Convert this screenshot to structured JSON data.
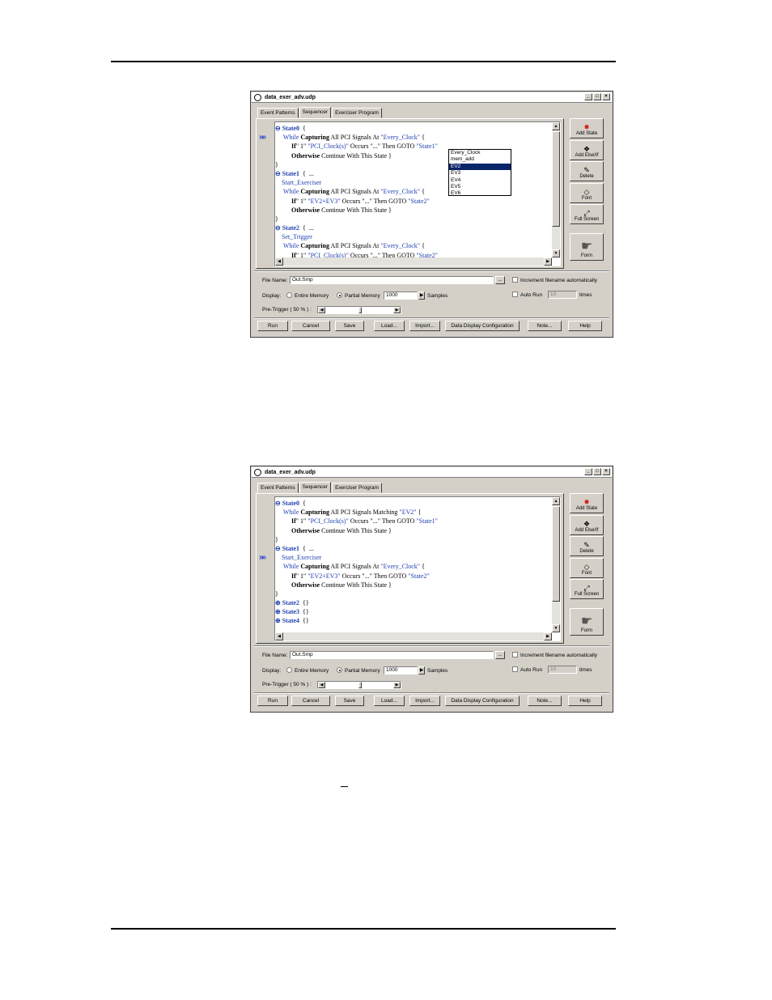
{
  "window1": {
    "title": "data_exer_adv.udp",
    "tabs": [
      "Event Patterns",
      "Sequencer",
      "Exerciser Program"
    ],
    "active_tab": "Sequencer",
    "code": [
      {
        "parts": [
          [
            "st",
            "⊖ State0"
          ],
          [
            "",
            "  {"
          ]
        ]
      },
      {
        "parts": [
          [
            "kw",
            "     While "
          ],
          [
            "bd",
            "Capturing"
          ],
          [
            "",
            " All PCI Signals At "
          ],
          [
            "str",
            "\"Every_Clock\""
          ],
          [
            "",
            " {"
          ]
        ]
      },
      {
        "parts": [
          [
            "bd",
            "          If"
          ],
          [
            "",
            "\" 1\" "
          ],
          [
            "str",
            "\"PCI_Clock(s)\""
          ],
          [
            "",
            " Occurs \"...\" Then GOTO "
          ],
          [
            "str",
            "\"State1\""
          ]
        ]
      },
      {
        "parts": [
          [
            "bd",
            "          Otherwise"
          ],
          [
            "",
            " Continue With This State }"
          ]
        ]
      },
      {
        "parts": [
          [
            "",
            "}"
          ]
        ]
      },
      {
        "parts": [
          [
            "st",
            "⊖ State1"
          ],
          [
            "",
            "  {  ..."
          ]
        ]
      },
      {
        "parts": [
          [
            "kw",
            "    Start_Exerciser"
          ]
        ]
      },
      {
        "parts": [
          [
            "kw",
            "     While "
          ],
          [
            "bd",
            "Capturing"
          ],
          [
            "",
            " All PCI Signals At "
          ],
          [
            "str",
            "\"Every_Clock\""
          ],
          [
            "",
            " {"
          ]
        ]
      },
      {
        "parts": [
          [
            "bd",
            "          If"
          ],
          [
            "",
            "\" 1\" "
          ],
          [
            "str",
            "\"EV2+EV3\""
          ],
          [
            "",
            " Occurs \"...\" Then GOTO "
          ],
          [
            "str",
            "\"State2\""
          ]
        ]
      },
      {
        "parts": [
          [
            "bd",
            "          Otherwise"
          ],
          [
            "",
            " Continue With This State }"
          ]
        ]
      },
      {
        "parts": [
          [
            "",
            "}"
          ]
        ]
      },
      {
        "parts": [
          [
            "st",
            "⊖ State2"
          ],
          [
            "",
            "  {  ..."
          ]
        ]
      },
      {
        "parts": [
          [
            "kw",
            "    Set_Trigger"
          ]
        ]
      },
      {
        "parts": [
          [
            "kw",
            "     While "
          ],
          [
            "bd",
            "Capturing"
          ],
          [
            "",
            " All PCI Signals At "
          ],
          [
            "str",
            "\"Every_Clock\""
          ],
          [
            "",
            " {"
          ]
        ]
      },
      {
        "parts": [
          [
            "bd",
            "          If"
          ],
          [
            "",
            "\" 1\" "
          ],
          [
            "str",
            "\"PCI_Clock(s)\""
          ],
          [
            "",
            " Occurs \"...\" Then GOTO "
          ],
          [
            "str",
            "\"State2\""
          ]
        ]
      }
    ],
    "dropdown": [
      "Every_Clock",
      "mem_add",
      "EV2",
      "EV3",
      "EV4",
      "EV5",
      "EV6"
    ],
    "dropdown_selected": "EV2"
  },
  "window2": {
    "title": "data_exer_adv.udp",
    "tabs": [
      "Event Patterns",
      "Sequencer",
      "Exerciser Program"
    ],
    "active_tab": "Sequencer",
    "code": [
      {
        "parts": [
          [
            "st",
            "⊖ State0"
          ],
          [
            "",
            "  {"
          ]
        ]
      },
      {
        "parts": [
          [
            "kw",
            "     While "
          ],
          [
            "bd",
            "Capturing"
          ],
          [
            "",
            " All PCI Signals Matching "
          ],
          [
            "str",
            "\"EV2\""
          ],
          [
            "",
            " {"
          ]
        ]
      },
      {
        "parts": [
          [
            "bd",
            "          If"
          ],
          [
            "",
            "\" 1\" "
          ],
          [
            "str",
            "\"PCI_Clock(s)\""
          ],
          [
            "",
            " Occurs \"...\" Then GOTO "
          ],
          [
            "str",
            "\"State1\""
          ]
        ]
      },
      {
        "parts": [
          [
            "bd",
            "          Otherwise"
          ],
          [
            "",
            " Continue With This State }"
          ]
        ]
      },
      {
        "parts": [
          [
            "",
            "}"
          ]
        ]
      },
      {
        "parts": [
          [
            "st",
            "⊖ State1"
          ],
          [
            "",
            "  {  ..."
          ]
        ]
      },
      {
        "parts": [
          [
            "kw",
            "    Start_Exerciser"
          ]
        ]
      },
      {
        "parts": [
          [
            "kw",
            "     While "
          ],
          [
            "bd",
            "Capturing"
          ],
          [
            "",
            " All PCI Signals At "
          ],
          [
            "str",
            "\"Every_Clock\""
          ],
          [
            "",
            " {"
          ]
        ]
      },
      {
        "parts": [
          [
            "bd",
            "          If"
          ],
          [
            "",
            "\" 1\" "
          ],
          [
            "str",
            "\"EV2+EV3\""
          ],
          [
            "",
            " Occurs \"...\" Then GOTO "
          ],
          [
            "str",
            "\"State2\""
          ]
        ]
      },
      {
        "parts": [
          [
            "bd",
            "          Otherwise"
          ],
          [
            "",
            " Continue With This State }"
          ]
        ]
      },
      {
        "parts": [
          [
            "",
            "}"
          ]
        ]
      },
      {
        "parts": [
          [
            "st",
            "⊕ State2"
          ],
          [
            "",
            "  {}"
          ]
        ]
      },
      {
        "parts": [
          [
            "st",
            "⊕ State3"
          ],
          [
            "",
            "  {}"
          ]
        ]
      },
      {
        "parts": [
          [
            "st",
            "⊕ State4"
          ],
          [
            "",
            "  {}"
          ]
        ]
      }
    ]
  },
  "side_buttons": [
    {
      "label": "Add State",
      "icon": "✸"
    },
    {
      "label": "Add Else/If",
      "icon": "❖"
    },
    {
      "label": "Delete",
      "icon": "✎"
    },
    {
      "label": "Font",
      "icon": "◇"
    },
    {
      "label": "Full Screen",
      "icon": "⤢"
    }
  ],
  "form_button": {
    "label": "Form",
    "icon": "☛"
  },
  "lower": {
    "file_name_label": "File Name:",
    "file_name_value": "Out.Smp",
    "browse_label": "...",
    "increment_label": "Increment filename automatically",
    "display_label": "Display:",
    "entire_memory": "Entire Memory",
    "partial_memory": "Partial Memory",
    "samples_value": "1000",
    "samples_label": "Samples",
    "auto_run_label": "Auto Run",
    "auto_run_value": "10",
    "times_label": "times",
    "pretrigger_label": "Pre-Trigger ( 50 % ) :"
  },
  "bottom_buttons": [
    "Run",
    "Cancel",
    "Save",
    "Load...",
    "Import...",
    "Data Display Configuration",
    "Note...",
    "Help"
  ]
}
